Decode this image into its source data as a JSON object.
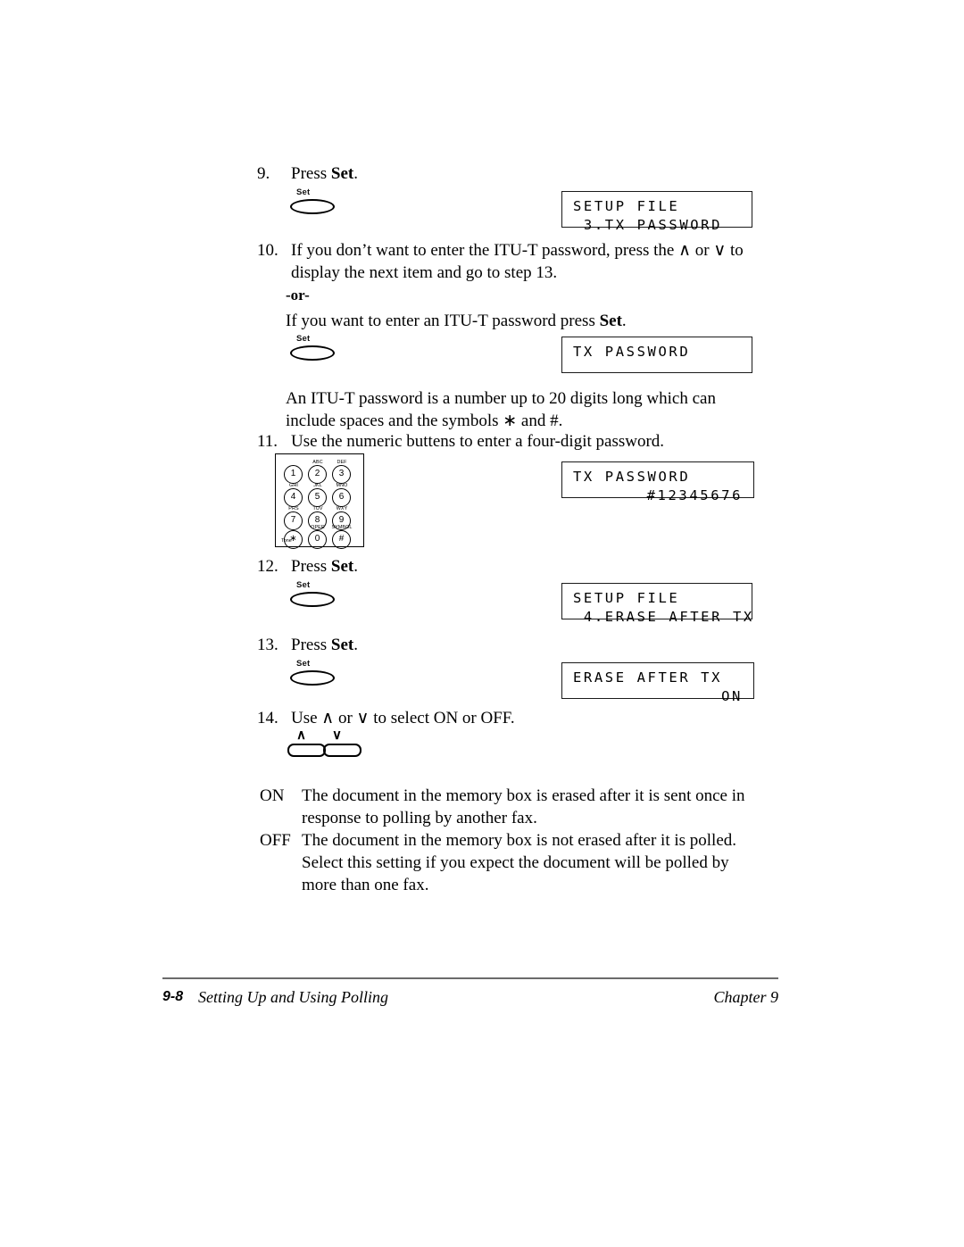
{
  "steps": {
    "s9": {
      "num": "9.",
      "text_before": "Press ",
      "bold": "Set",
      "text_after": "."
    },
    "s10": {
      "num": "10.",
      "line1": "If you don’t want to enter the ITU-T password, press the ∧ or ∨ to",
      "line2": "display the next item and go to step 13."
    },
    "or": "-or-",
    "s10b": {
      "text_before": "If you want to enter an ITU-T password press ",
      "bold": "Set",
      "text_after": "."
    },
    "note": {
      "line1": "An ITU-T password is a number up to 20 digits long which can",
      "line2": "include spaces and the symbols ∗ and #."
    },
    "s11": {
      "num": "11.",
      "text": "Use the numeric buttens to enter a four-digit password."
    },
    "s12": {
      "num": "12.",
      "text_before": "Press ",
      "bold": "Set",
      "text_after": "."
    },
    "s13": {
      "num": "13.",
      "text_before": "Press ",
      "bold": "Set",
      "text_after": "."
    },
    "s14": {
      "num": "14.",
      "text": "Use ∧ or ∨ to select ON or OFF."
    }
  },
  "buttons": {
    "set_label": "Set",
    "up_glyph": "∧",
    "down_glyph": "∨"
  },
  "lcd": {
    "d1": {
      "line1": "SETUP FILE",
      "line2": " 3.TX PASSWORD"
    },
    "d2": {
      "line1": "TX PASSWORD",
      "line2": ""
    },
    "d3": {
      "line1": "TX PASSWORD",
      "line2": "#12345676"
    },
    "d4": {
      "line1": "SETUP FILE",
      "line2": " 4.ERASE AFTER TX"
    },
    "d5": {
      "line1": "ERASE AFTER TX",
      "line2": "ON"
    }
  },
  "keypad": {
    "keys": [
      {
        "digit": "1",
        "letters": ""
      },
      {
        "digit": "2",
        "letters": "ABC"
      },
      {
        "digit": "3",
        "letters": "DEF"
      },
      {
        "digit": "4",
        "letters": "GHI"
      },
      {
        "digit": "5",
        "letters": "JKL"
      },
      {
        "digit": "6",
        "letters": "MNO"
      },
      {
        "digit": "7",
        "letters": "PRS"
      },
      {
        "digit": "8",
        "letters": "TUV"
      },
      {
        "digit": "9",
        "letters": "WXY"
      },
      {
        "digit": "∗",
        "letters": ""
      },
      {
        "digit": "0",
        "letters": "OPER"
      },
      {
        "digit": "#",
        "letters": "SYMBOL"
      }
    ],
    "tone_label": "Tone"
  },
  "definitions": [
    {
      "term": "ON",
      "line1": "The document in the memory box is erased after it is sent once in",
      "line2": "response to polling by another fax.",
      "line3": ""
    },
    {
      "term": "OFF",
      "line1": "The document in the memory box is not erased after it is polled.",
      "line2": "Select this setting if you expect the document will be polled by",
      "line3": "more than one fax."
    }
  ],
  "footer": {
    "page_number": "9-8",
    "section_title": "Setting Up and Using Polling",
    "chapter": "Chapter 9"
  }
}
